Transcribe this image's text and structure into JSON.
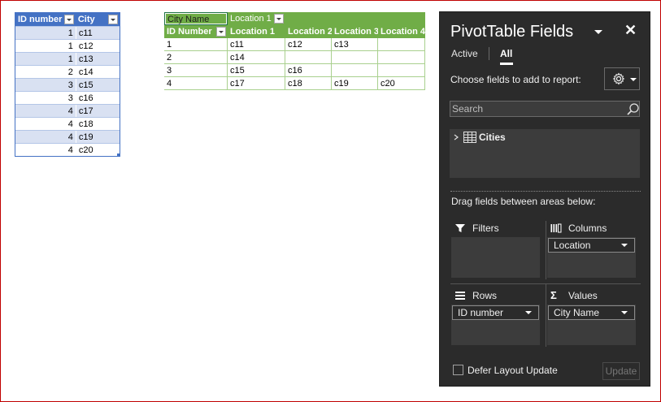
{
  "source_table": {
    "headers": [
      "ID number",
      "City"
    ],
    "rows": [
      [
        "1",
        "c11"
      ],
      [
        "1",
        "c12"
      ],
      [
        "1",
        "c13"
      ],
      [
        "2",
        "c14"
      ],
      [
        "3",
        "c15"
      ],
      [
        "3",
        "c16"
      ],
      [
        "4",
        "c17"
      ],
      [
        "4",
        "c18"
      ],
      [
        "4",
        "c19"
      ],
      [
        "4",
        "c20"
      ]
    ]
  },
  "pivot": {
    "values_field": "City Name",
    "column_field": "Location",
    "column_filter_value": "1",
    "row_header": "ID Number",
    "col_headers": [
      "Location 1",
      "Location 2",
      "Location 3",
      "Location 4"
    ],
    "rows": [
      [
        "1",
        "c11",
        "c12",
        "c13",
        ""
      ],
      [
        "2",
        "c14",
        "",
        "",
        ""
      ],
      [
        "3",
        "c15",
        "c16",
        "",
        ""
      ],
      [
        "4",
        "c17",
        "c18",
        "c19",
        "c20"
      ]
    ]
  },
  "pane": {
    "title": "PivotTable Fields",
    "close": "✕",
    "tabs": {
      "active": "Active",
      "all": "All"
    },
    "choose_label": "Choose fields to add to report:",
    "search_placeholder": "Search",
    "field": "Cities",
    "drag_label": "Drag fields between areas below:",
    "areas": {
      "filters": {
        "label": "Filters",
        "items": []
      },
      "columns": {
        "label": "Columns",
        "items": [
          "Location"
        ]
      },
      "rows": {
        "label": "Rows",
        "items": [
          "ID number"
        ]
      },
      "values": {
        "label": "Values",
        "items": [
          "City Name"
        ]
      }
    },
    "defer_label": "Defer Layout Update",
    "update_label": "Update"
  },
  "colors": {
    "source_header": "#4472c4",
    "source_band": "#d9e1f2",
    "pivot_header": "#70ad47",
    "pane_bg": "#2b2b2b"
  }
}
